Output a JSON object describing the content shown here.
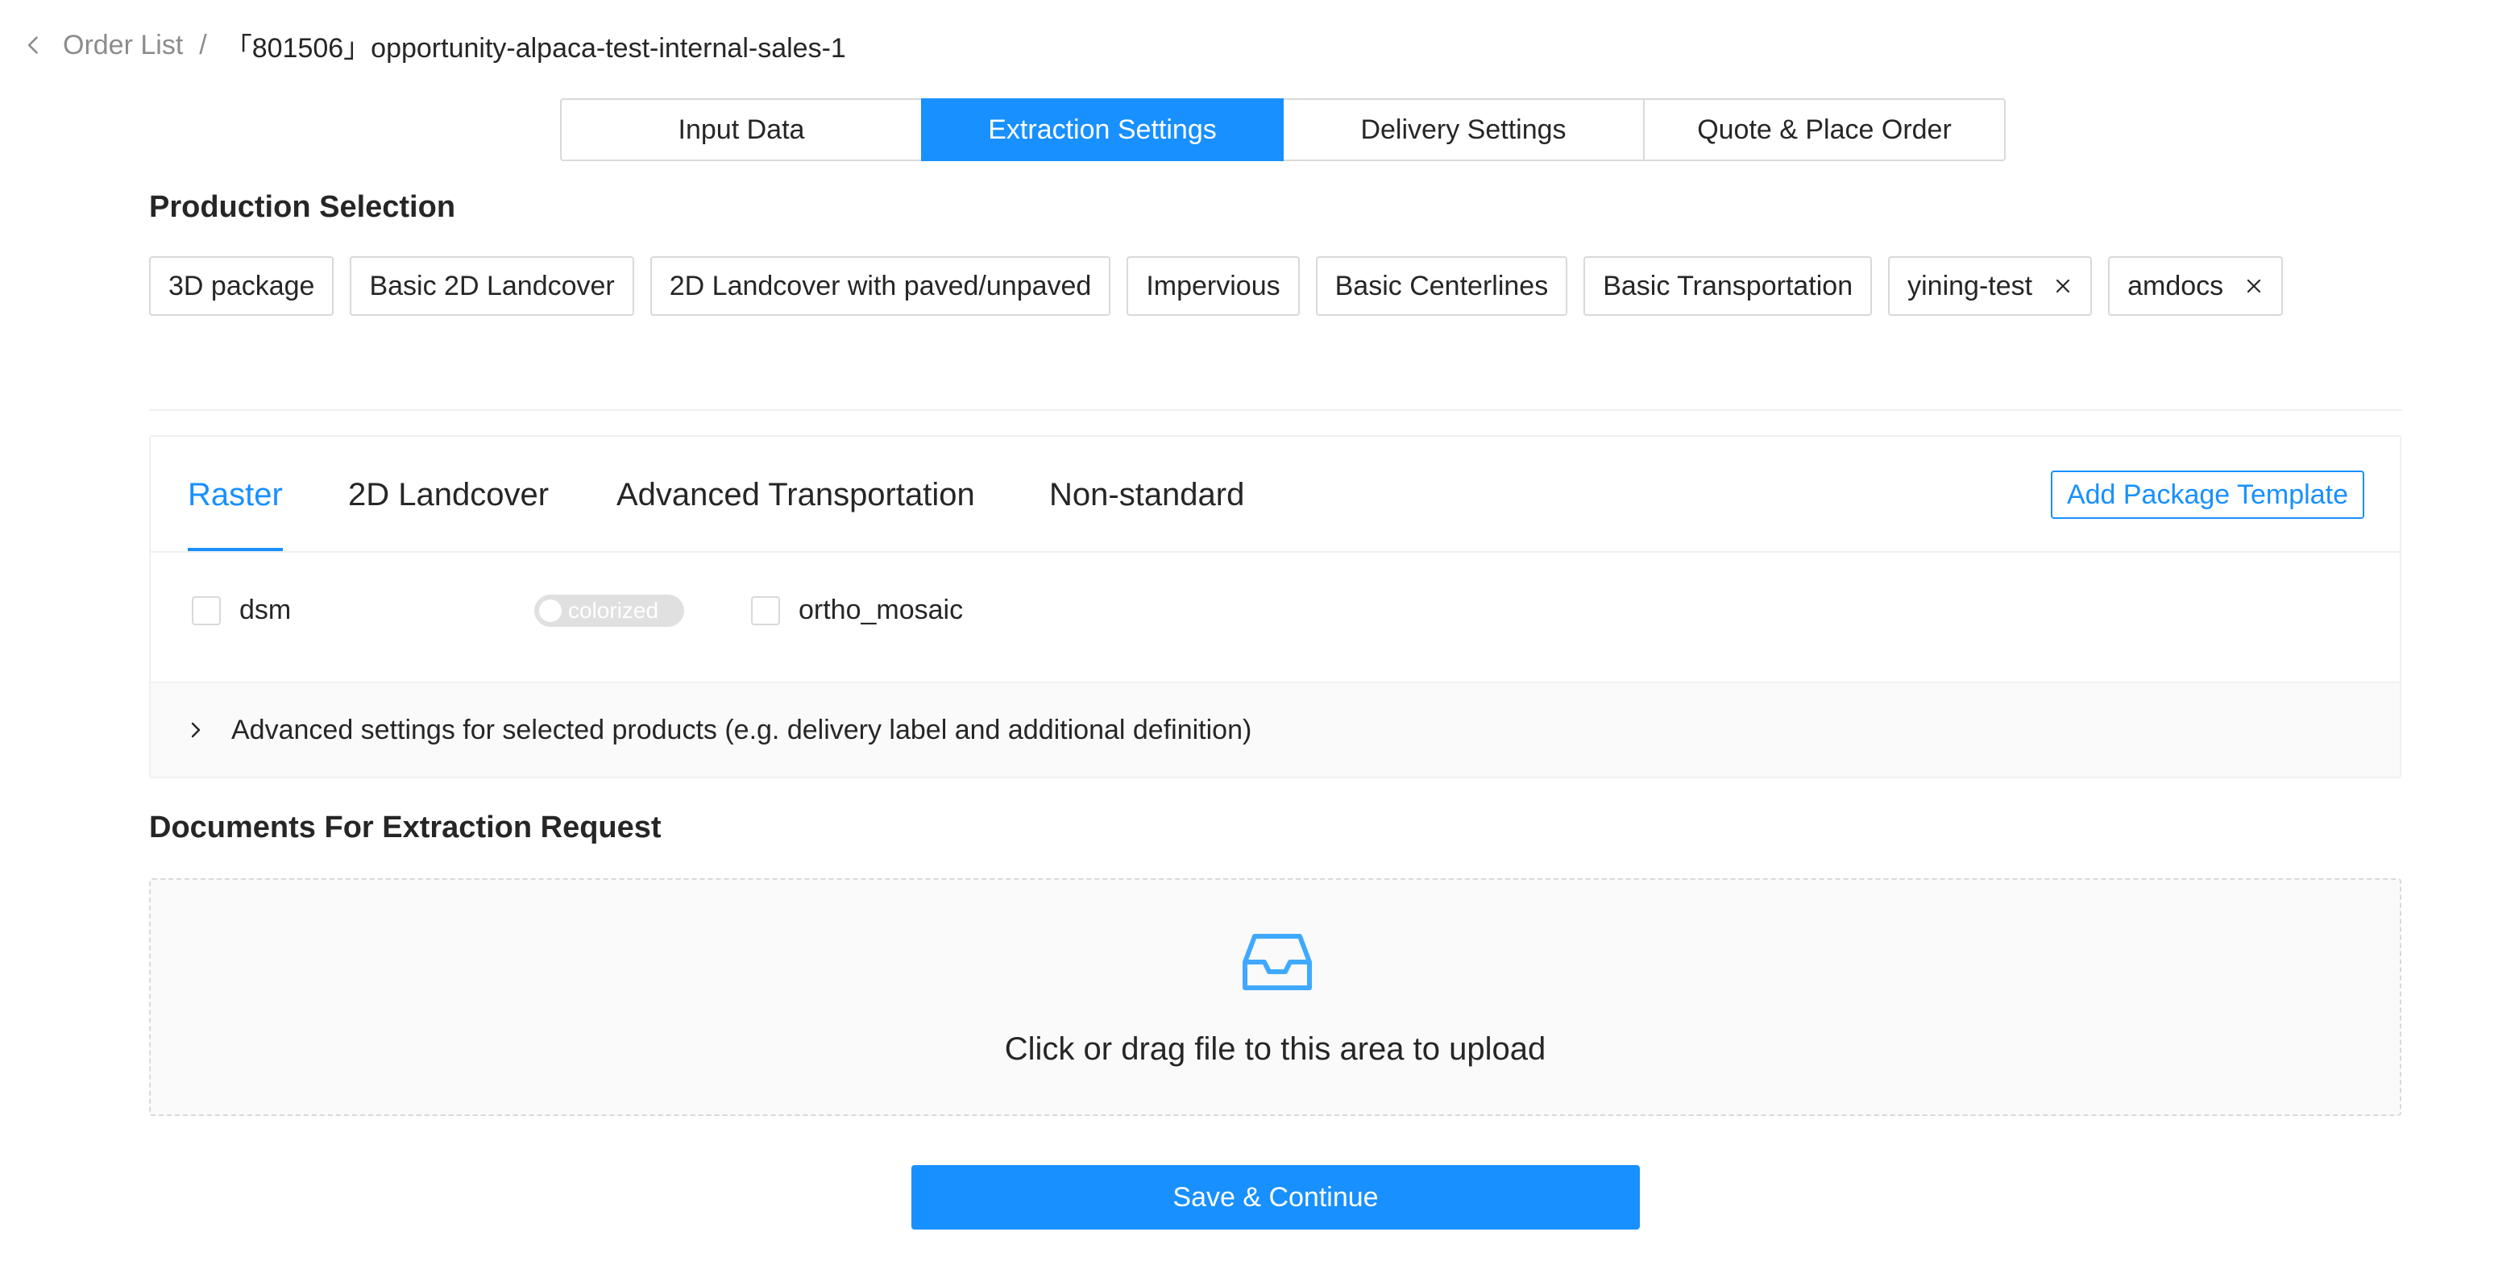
{
  "breadcrumb": {
    "back_label": "Order List",
    "separator": "/",
    "current": "「801506」opportunity-alpaca-test-internal-sales-1"
  },
  "steps": [
    {
      "label": "Input Data"
    },
    {
      "label": "Extraction Settings"
    },
    {
      "label": "Delivery Settings"
    },
    {
      "label": "Quote & Place Order"
    }
  ],
  "production_selection": {
    "title": "Production Selection",
    "tags": [
      {
        "label": "3D package"
      },
      {
        "label": "Basic 2D Landcover"
      },
      {
        "label": "2D Landcover with paved/unpaved"
      },
      {
        "label": "Impervious"
      },
      {
        "label": "Basic Centerlines"
      },
      {
        "label": "Basic Transportation"
      },
      {
        "label": "yining-test",
        "closable": true
      },
      {
        "label": "amdocs",
        "closable": true
      }
    ]
  },
  "product_tabs": [
    {
      "label": "Raster",
      "active": true
    },
    {
      "label": "2D Landcover"
    },
    {
      "label": "Advanced Transportation"
    },
    {
      "label": "Non-standard"
    }
  ],
  "add_template_label": "Add Package Template",
  "products": {
    "dsm_label": "dsm",
    "colorized_label": "colorized",
    "ortho_label": "ortho_mosaic"
  },
  "advanced_settings_label": "Advanced settings for selected products (e.g. delivery label and additional definition)",
  "documents": {
    "title": "Documents For Extraction Request",
    "upload_text": "Click or drag file to this area to upload"
  },
  "save_label": "Save & Continue",
  "colors": {
    "primary": "#1890ff",
    "border": "#d9d9d9",
    "text": "#262626",
    "muted": "#8c8c8c"
  }
}
